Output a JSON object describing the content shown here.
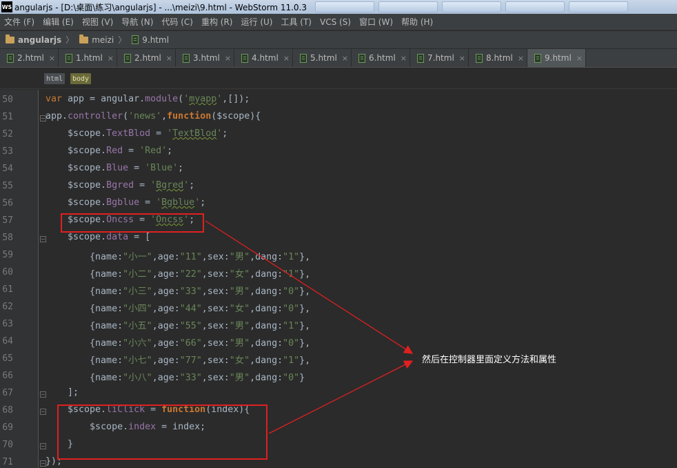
{
  "window": {
    "title": "angularjs - [D:\\桌面\\练习\\angularjs] - ...\\meizi\\9.html - WebStorm 11.0.3",
    "icon_label": "WS"
  },
  "menu": [
    "文件 (F)",
    "编辑 (E)",
    "视图 (V)",
    "导航 (N)",
    "代码 (C)",
    "重构 (R)",
    "运行 (U)",
    "工具 (T)",
    "VCS (S)",
    "窗口 (W)",
    "帮助 (H)"
  ],
  "breadcrumb": {
    "project": "angularjs",
    "folder": "meizi",
    "file": "9.html"
  },
  "tabs": [
    {
      "label": "2.html"
    },
    {
      "label": "1.html"
    },
    {
      "label": "2.html"
    },
    {
      "label": "3.html"
    },
    {
      "label": "4.html"
    },
    {
      "label": "5.html"
    },
    {
      "label": "6.html"
    },
    {
      "label": "7.html"
    },
    {
      "label": "8.html"
    },
    {
      "label": "9.html",
      "active": true
    }
  ],
  "tab_close_glyph": "×",
  "structure": {
    "html": "html",
    "body": "body"
  },
  "editor": {
    "line_numbers": [
      "50",
      "51",
      "52",
      "53",
      "54",
      "55",
      "56",
      "57",
      "58",
      "59",
      "60",
      "61",
      "62",
      "63",
      "64",
      "65",
      "66",
      "67",
      "68",
      "69",
      "70",
      "71"
    ],
    "code_lines": [
      "var app = angular.module('myapp',[]);",
      "app.controller('news',function($scope){",
      "    $scope.TextBlod = 'TextBlod';",
      "    $scope.Red = 'Red';",
      "    $scope.Blue = 'Blue';",
      "    $scope.Bgred = 'Bgred';",
      "    $scope.Bgblue = 'Bgblue';",
      "    $scope.Oncss = 'Oncss';",
      "    $scope.data = [",
      "        {name:\"小一\",age:\"11\",sex:\"男\",dang:\"1\"},",
      "        {name:\"小二\",age:\"22\",sex:\"女\",dang:\"1\"},",
      "        {name:\"小三\",age:\"33\",sex:\"男\",dang:\"0\"},",
      "        {name:\"小四\",age:\"44\",sex:\"女\",dang:\"0\"},",
      "        {name:\"小五\",age:\"55\",sex:\"男\",dang:\"1\"},",
      "        {name:\"小六\",age:\"66\",sex:\"男\",dang:\"0\"},",
      "        {name:\"小七\",age:\"77\",sex:\"女\",dang:\"1\"},",
      "        {name:\"小八\",age:\"33\",sex:\"男\",dang:\"0\"}",
      "    ];",
      "    $scope.liClick = function(index){",
      "        $scope.index = index;",
      "    }",
      "});"
    ]
  },
  "annotation": {
    "note": "然后在控制器里面定义方法和属性",
    "color": "#e02020"
  },
  "colors": {
    "keyword": "#cc7832",
    "string": "#6a8759",
    "function": "#ffc66d",
    "property": "#9876aa",
    "default": "#a9b7c6"
  }
}
